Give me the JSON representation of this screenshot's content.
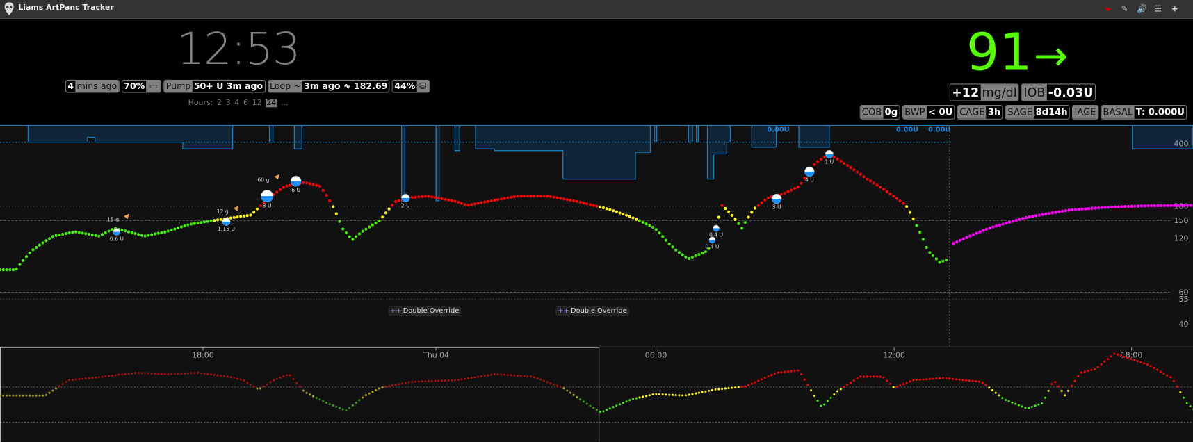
{
  "app": {
    "title": "Liams ArtPanc Tracker"
  },
  "toolbar": {
    "icons": [
      "alarm-icon",
      "edit-icon",
      "volume-icon",
      "menu-icon",
      "plus-icon"
    ]
  },
  "clock": {
    "time": "12:53"
  },
  "status": {
    "ago": {
      "value": "4",
      "label": "mins ago"
    },
    "battery": {
      "value": "70%"
    },
    "pump": {
      "label": "Pump",
      "value": "50+ U 3m ago"
    },
    "loop": {
      "label": "Loop ~",
      "value": "3m ago ∿ 182.69"
    },
    "database": {
      "value": "44%"
    }
  },
  "hours": {
    "label": "Hours:",
    "options": [
      "2",
      "3",
      "4",
      "6",
      "12",
      "24"
    ],
    "selected": "24",
    "more": "..."
  },
  "bg": {
    "value": "91",
    "direction": "→",
    "color": "#55ff00"
  },
  "delta": {
    "value": "+12",
    "unit": "mg/dl"
  },
  "iob": {
    "label": "IOB",
    "value": "-0.03U"
  },
  "pills": [
    {
      "label": "COB",
      "value": "0g"
    },
    {
      "label": "BWP",
      "value": "< 0U"
    },
    {
      "label": "CAGE",
      "value": "3h"
    },
    {
      "label": "SAGE",
      "value": "8d14h"
    },
    {
      "label": "IAGE",
      "value": ""
    },
    {
      "label": "BASAL",
      "value": "T: 0.000U"
    }
  ],
  "colors": {
    "high": "#ff0000",
    "warn": "#ffff00",
    "inrange": "#44ee00",
    "forecast": "#ff00ff",
    "basal": "#1a7ab8"
  },
  "chart_data": {
    "type": "scatter",
    "y_scale": "log",
    "ylim": [
      40,
      400
    ],
    "y_ticks": [
      "400",
      "180",
      "150",
      "120",
      "60",
      "55",
      "40"
    ],
    "thresholds": {
      "high": 180,
      "target_top": 150,
      "target_bottom": 60,
      "low": 55
    },
    "readings_keypoints": [
      [
        -24,
        80
      ],
      [
        -23.6,
        80
      ],
      [
        -23.2,
        102
      ],
      [
        -22.65,
        123
      ],
      [
        -22.1,
        130
      ],
      [
        -21.5,
        123
      ],
      [
        -21.1,
        136
      ],
      [
        -20.35,
        123
      ],
      [
        -19.8,
        130
      ],
      [
        -19.2,
        143
      ],
      [
        -18.6,
        150
      ],
      [
        -18,
        157
      ],
      [
        -17.65,
        161
      ],
      [
        -17.3,
        191
      ],
      [
        -16.8,
        232
      ],
      [
        -16.3,
        244
      ],
      [
        -15.9,
        232
      ],
      [
        -15.6,
        182
      ],
      [
        -15.35,
        136
      ],
      [
        -15.1,
        117
      ],
      [
        -14.85,
        130
      ],
      [
        -14.4,
        150
      ],
      [
        -14,
        191
      ],
      [
        -13.7,
        200
      ],
      [
        -13.2,
        205
      ],
      [
        -12.45,
        191
      ],
      [
        -12.2,
        182
      ],
      [
        -11.7,
        191
      ],
      [
        -10.9,
        205
      ],
      [
        -10.15,
        205
      ],
      [
        -9.4,
        191
      ],
      [
        -8.6,
        173
      ],
      [
        -8.05,
        157
      ],
      [
        -7.45,
        136
      ],
      [
        -7.1,
        112
      ],
      [
        -6.9,
        102
      ],
      [
        -6.6,
        92
      ],
      [
        -6.1,
        102
      ],
      [
        -5.9,
        136
      ],
      [
        -5.75,
        182
      ],
      [
        -5.55,
        165
      ],
      [
        -5.25,
        136
      ],
      [
        -4.95,
        173
      ],
      [
        -4.6,
        200
      ],
      [
        -4.2,
        211
      ],
      [
        -3.8,
        232
      ],
      [
        -3.4,
        310
      ],
      [
        -3.05,
        352
      ],
      [
        -2.65,
        310
      ],
      [
        -2.1,
        256
      ],
      [
        -1.5,
        211
      ],
      [
        -1.1,
        182
      ],
      [
        -0.85,
        143
      ],
      [
        -0.55,
        102
      ],
      [
        -0.25,
        88
      ],
      [
        -0.05,
        91
      ]
    ],
    "forecast_keypoints": [
      [
        0.1,
        112
      ],
      [
        1,
        136
      ],
      [
        2,
        157
      ],
      [
        3,
        171
      ],
      [
        4,
        178
      ],
      [
        5,
        181
      ],
      [
        6.15,
        182
      ]
    ],
    "basal_steps": [
      [
        -24,
        0
      ],
      [
        -23.29,
        1.0
      ],
      [
        -21.79,
        0.7
      ],
      [
        -21.6,
        1.0
      ],
      [
        -19.38,
        1.4
      ],
      [
        -18.12,
        0
      ],
      [
        -17.19,
        1.0
      ],
      [
        -17.1,
        0
      ],
      [
        -16.56,
        1.4
      ],
      [
        -16.37,
        0
      ],
      [
        -13.85,
        4.5
      ],
      [
        -13.77,
        0
      ],
      [
        -12.98,
        4.5
      ],
      [
        -12.9,
        0
      ],
      [
        -12.5,
        1.5
      ],
      [
        -12.38,
        0
      ],
      [
        -11.98,
        1.4
      ],
      [
        -11.5,
        1.5
      ],
      [
        -9.77,
        3.2
      ],
      [
        -7.94,
        1.6
      ],
      [
        -7.56,
        0
      ],
      [
        -7.46,
        1.0
      ],
      [
        -7.4,
        0
      ],
      [
        -6.6,
        1.0
      ],
      [
        -6.5,
        0
      ],
      [
        -6.4,
        1.0
      ],
      [
        -6.35,
        0
      ],
      [
        -6.12,
        3.2
      ],
      [
        -5.96,
        1.7
      ],
      [
        -5.63,
        1.0
      ],
      [
        -5.54,
        0
      ],
      [
        -5.0,
        1.3
      ],
      [
        -4.38,
        0
      ],
      [
        -3.81,
        1.3
      ],
      [
        -3.04,
        0
      ],
      [
        4.62,
        1.4
      ],
      [
        6.15,
        1.4
      ]
    ],
    "basal_labels": [
      {
        "t": -4.13,
        "text": "0.00U"
      },
      {
        "t": -0.87,
        "text": "0.00U"
      },
      {
        "t": -0.06,
        "text": "0.00U"
      }
    ],
    "carbs": [
      {
        "t": -21.1,
        "mg": 140,
        "text": "15 g"
      },
      {
        "t": -18.33,
        "mg": 155,
        "text": "12 g"
      },
      {
        "t": -17.3,
        "mg": 232,
        "text": "60 g"
      }
    ],
    "boluses": [
      {
        "t": -21.05,
        "mg": 130,
        "text": "0.6 U",
        "size": 0.4
      },
      {
        "t": -18.28,
        "mg": 148,
        "text": "1.15 U",
        "size": 0.5
      },
      {
        "t": -17.25,
        "mg": 205,
        "text": "8 U",
        "size": 1
      },
      {
        "t": -16.52,
        "mg": 248,
        "text": "6 U",
        "size": 0.8
      },
      {
        "t": -13.75,
        "mg": 200,
        "text": "2 U",
        "size": 0.5
      },
      {
        "t": -6.0,
        "mg": 117,
        "text": "0.4 U",
        "size": 0.3
      },
      {
        "t": -5.9,
        "mg": 136,
        "text": "0.4 U",
        "size": 0.3
      },
      {
        "t": -4.37,
        "mg": 198,
        "text": "3 U",
        "size": 0.7
      },
      {
        "t": -3.54,
        "mg": 280,
        "text": "4 U",
        "size": 0.7
      },
      {
        "t": -3.04,
        "mg": 350,
        "text": "1 U",
        "size": 0.5
      }
    ],
    "overrides": [
      {
        "t": -14.2,
        "text": "Double Override"
      },
      {
        "t": -9.96,
        "text": "Double Override"
      }
    ],
    "brush": {
      "x_ticks": [
        {
          "h": 5.13,
          "label": "18:00"
        },
        {
          "h": 11.02,
          "label": "Thu 04"
        },
        {
          "h": 16.58,
          "label": "06:00"
        },
        {
          "h": 22.6,
          "label": "12:00"
        },
        {
          "h": 28.6,
          "label": "18:00"
        }
      ],
      "selection_hours": [
        0,
        15.13
      ],
      "keypoints": [
        [
          0,
          156
        ],
        [
          1.15,
          156
        ],
        [
          1.73,
          200
        ],
        [
          2.31,
          206
        ],
        [
          3.46,
          221
        ],
        [
          4.23,
          217
        ],
        [
          5,
          221
        ],
        [
          5.77,
          210
        ],
        [
          6.15,
          200
        ],
        [
          6.54,
          173
        ],
        [
          6.92,
          200
        ],
        [
          7.31,
          217
        ],
        [
          7.69,
          167
        ],
        [
          8.27,
          134
        ],
        [
          8.75,
          113
        ],
        [
          9.23,
          156
        ],
        [
          9.62,
          178
        ],
        [
          10.38,
          195
        ],
        [
          11.54,
          200
        ],
        [
          12.5,
          217
        ],
        [
          13.46,
          210
        ],
        [
          14.23,
          178
        ],
        [
          14.81,
          134
        ],
        [
          15.19,
          108
        ],
        [
          15.96,
          145
        ],
        [
          16.54,
          160
        ],
        [
          17.31,
          156
        ],
        [
          18.08,
          173
        ],
        [
          18.85,
          182
        ],
        [
          19.62,
          221
        ],
        [
          20.19,
          228
        ],
        [
          20.58,
          156
        ],
        [
          20.77,
          123
        ],
        [
          21.15,
          167
        ],
        [
          21.73,
          210
        ],
        [
          22.31,
          210
        ],
        [
          22.6,
          178
        ],
        [
          23.08,
          200
        ],
        [
          23.85,
          206
        ],
        [
          24.81,
          195
        ],
        [
          25.38,
          145
        ],
        [
          25.96,
          119
        ],
        [
          26.35,
          134
        ],
        [
          26.63,
          200
        ],
        [
          26.92,
          156
        ],
        [
          27.31,
          221
        ],
        [
          27.69,
          232
        ],
        [
          28.17,
          276
        ],
        [
          28.46,
          265
        ],
        [
          29.04,
          243
        ],
        [
          29.62,
          206
        ],
        [
          30,
          134
        ],
        [
          30.38,
          95
        ]
      ]
    }
  }
}
